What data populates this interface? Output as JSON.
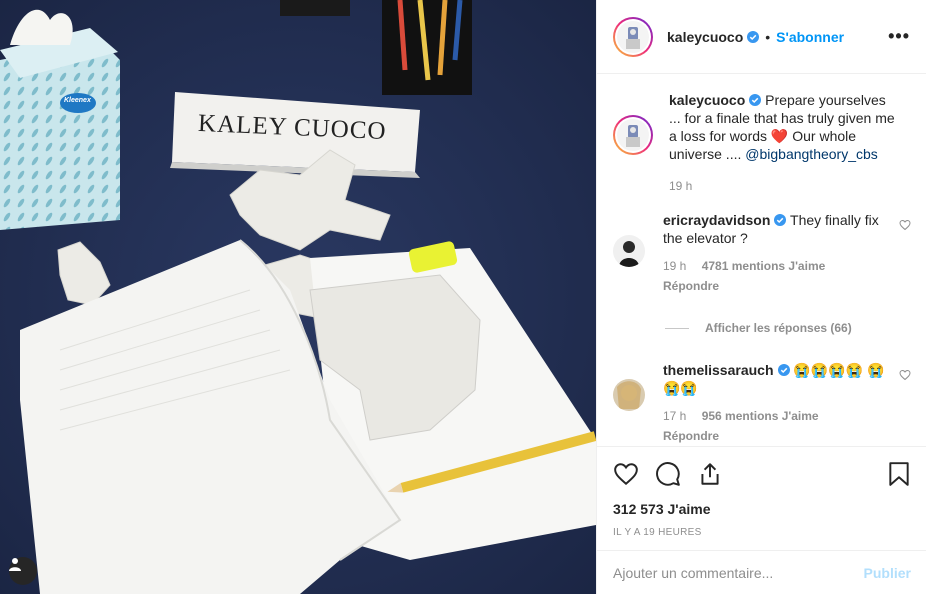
{
  "post": {
    "username": "kaleycuoco",
    "follow_label": "S'abonner",
    "more_label": "•••",
    "name_card_text": "KALEY CUOCO",
    "tissue_brand": "Kleenex"
  },
  "caption": {
    "username": "kaleycuoco",
    "text": "Prepare yourselves ... for a finale that has truly given me a loss for words ❤️ Our whole universe ....",
    "mention": "@bigbangtheory_cbs",
    "time": "19 h"
  },
  "comments": [
    {
      "username": "ericraydavidson",
      "text": "They finally fix the elevator ?",
      "time": "19 h",
      "likes": "4781 mentions J'aime",
      "reply_label": "Répondre",
      "view_replies": "Afficher les réponses (66)"
    },
    {
      "username": "themelissarauch",
      "text": "😭😭😭😭 😭😭😭",
      "time": "17 h",
      "likes": "956 mentions J'aime",
      "reply_label": "Répondre"
    }
  ],
  "engagement": {
    "likes": "312 573 J'aime",
    "time_ago": "IL Y A 19 HEURES"
  },
  "composer": {
    "placeholder": "Ajouter un commentaire...",
    "publish_label": "Publier"
  },
  "colors": {
    "accent": "#0095f6",
    "verified": "#3897f0",
    "publish_disabled": "#b2dffc"
  },
  "icons": [
    "verified-icon",
    "heart-icon",
    "comment-icon",
    "share-icon",
    "bookmark-icon",
    "user-tag-icon"
  ]
}
